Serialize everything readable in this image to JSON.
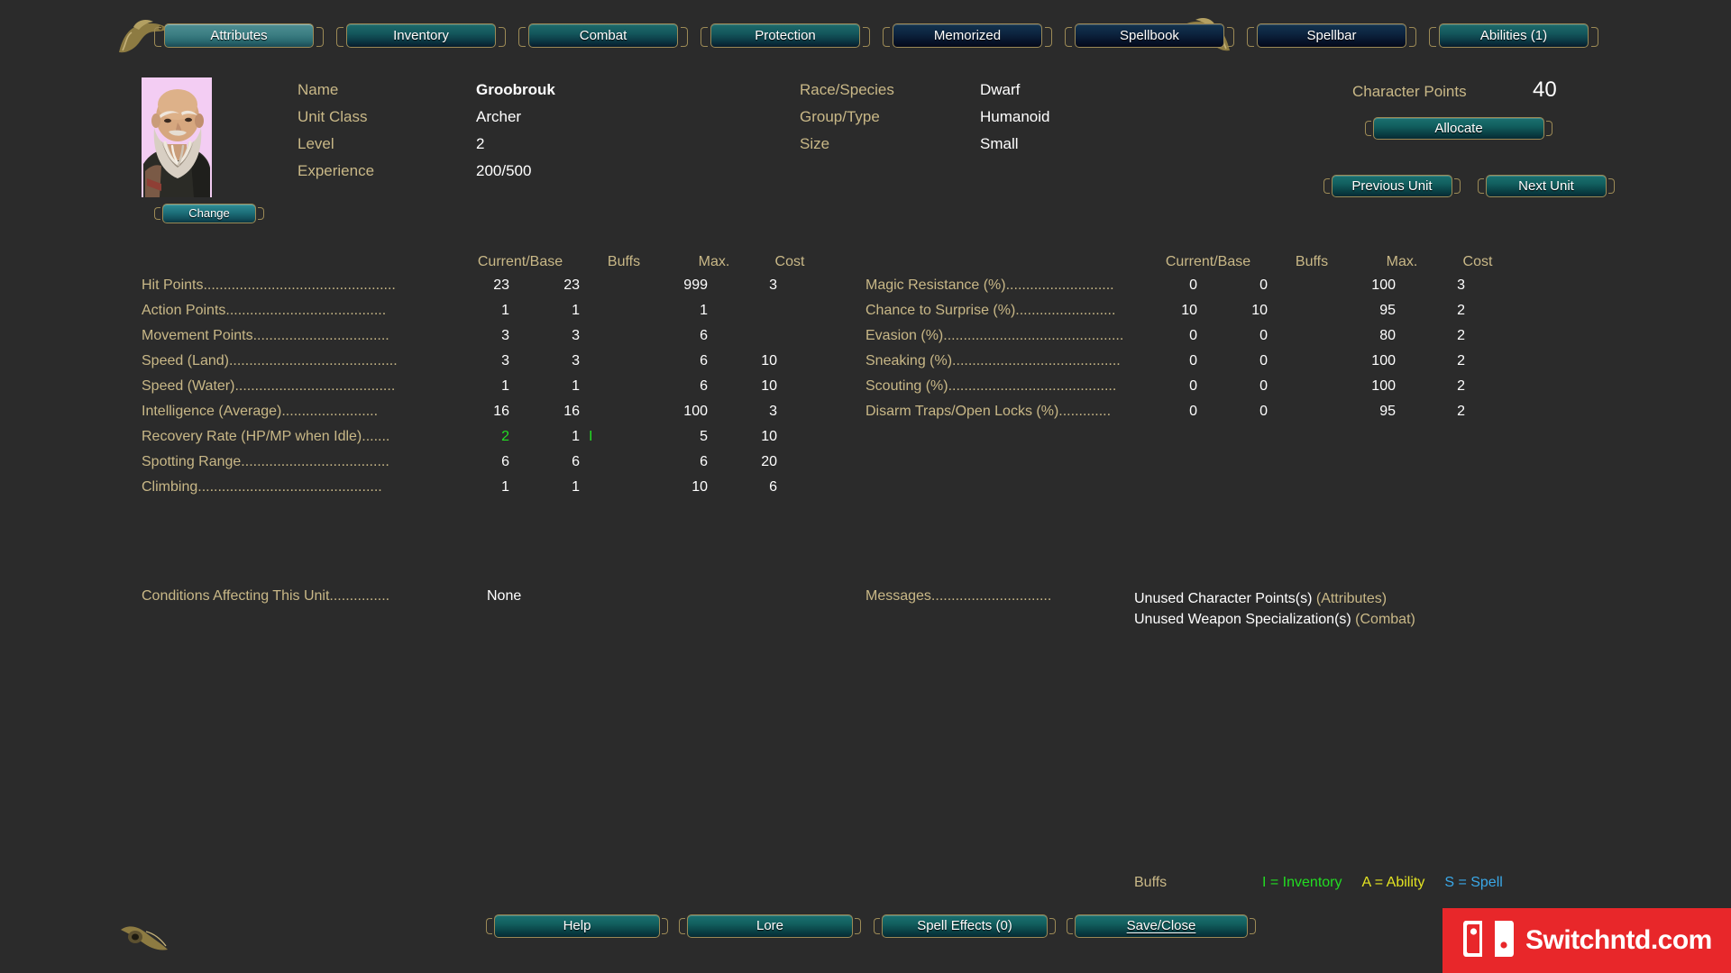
{
  "tabs": [
    {
      "label": "Attributes",
      "state": "active"
    },
    {
      "label": "Inventory",
      "state": "enabled"
    },
    {
      "label": "Combat",
      "state": "enabled"
    },
    {
      "label": "Protection",
      "state": "enabled"
    },
    {
      "label": "Memorized",
      "state": "disabled"
    },
    {
      "label": "Spellbook",
      "state": "disabled"
    },
    {
      "label": "Spellbar",
      "state": "disabled"
    },
    {
      "label": "Abilities (1)",
      "state": "enabled"
    }
  ],
  "character": {
    "portrait_change_label": "Change",
    "fields_left": [
      {
        "label": "Name",
        "value": "Groobrouk",
        "bold": true
      },
      {
        "label": "Unit Class",
        "value": "Archer",
        "bold": false
      },
      {
        "label": "Level",
        "value": "2",
        "bold": false
      },
      {
        "label": "Experience",
        "value": "200/500",
        "bold": false
      }
    ],
    "fields_mid": [
      {
        "label": "Race/Species",
        "value": "Dwarf"
      },
      {
        "label": "Group/Type",
        "value": "Humanoid"
      },
      {
        "label": "Size",
        "value": "Small"
      }
    ],
    "character_points_label": "Character Points",
    "character_points_value": "40",
    "allocate_label": "Allocate",
    "previous_unit_label": "Previous Unit",
    "next_unit_label": "Next Unit"
  },
  "columns": {
    "current_base": "Current/Base",
    "buffs": "Buffs",
    "max": "Max.",
    "cost": "Cost"
  },
  "stats_left": [
    {
      "name": "Hit Points",
      "dots": "................................................",
      "current": "23",
      "base": "23",
      "buff": "",
      "max": "999",
      "cost": "3",
      "current_green": false
    },
    {
      "name": "Action Points",
      "dots": "........................................",
      "current": "1",
      "base": "1",
      "buff": "",
      "max": "1",
      "cost": "",
      "current_green": false
    },
    {
      "name": "Movement Points",
      "dots": "..................................",
      "current": "3",
      "base": "3",
      "buff": "",
      "max": "6",
      "cost": "",
      "current_green": false
    },
    {
      "name": "Speed (Land)",
      "dots": "..........................................",
      "current": "3",
      "base": "3",
      "buff": "",
      "max": "6",
      "cost": "10",
      "current_green": false
    },
    {
      "name": "Speed (Water)",
      "dots": "........................................",
      "current": "1",
      "base": "1",
      "buff": "",
      "max": "6",
      "cost": "10",
      "current_green": false
    },
    {
      "name": "Intelligence (Average)",
      "dots": "........................",
      "current": "16",
      "base": "16",
      "buff": "",
      "max": "100",
      "cost": "3",
      "current_green": false
    },
    {
      "name": "Recovery Rate (HP/MP when Idle)",
      "dots": ".......",
      "current": "2",
      "base": "1",
      "buff": "I",
      "max": "5",
      "cost": "10",
      "current_green": true
    },
    {
      "name": "Spotting Range",
      "dots": ".....................................",
      "current": "6",
      "base": "6",
      "buff": "",
      "max": "6",
      "cost": "20",
      "current_green": false
    },
    {
      "name": "Climbing",
      "dots": "..............................................",
      "current": "1",
      "base": "1",
      "buff": "",
      "max": "10",
      "cost": "6",
      "current_green": false
    }
  ],
  "stats_right": [
    {
      "name": "Magic Resistance (%)",
      "dots": "...........................",
      "current": "0",
      "base": "0",
      "buff": "",
      "max": "100",
      "cost": "3"
    },
    {
      "name": "Chance to Surprise (%)",
      "dots": ".........................",
      "current": "10",
      "base": "10",
      "buff": "",
      "max": "95",
      "cost": "2"
    },
    {
      "name": "Evasion (%)",
      "dots": ".............................................",
      "current": "0",
      "base": "0",
      "buff": "",
      "max": "80",
      "cost": "2"
    },
    {
      "name": "Sneaking (%)",
      "dots": "..........................................",
      "current": "0",
      "base": "0",
      "buff": "",
      "max": "100",
      "cost": "2"
    },
    {
      "name": "Scouting (%)",
      "dots": "..........................................",
      "current": "0",
      "base": "0",
      "buff": "",
      "max": "100",
      "cost": "2"
    },
    {
      "name": "Disarm Traps/Open Locks (%)",
      "dots": ".............",
      "current": "0",
      "base": "0",
      "buff": "",
      "max": "95",
      "cost": "2"
    }
  ],
  "conditions": {
    "label": "Conditions Affecting This Unit...............",
    "value": "None"
  },
  "messages": {
    "label": "Messages..............................",
    "items": [
      {
        "text": "Unused Character Points(s) ",
        "context": "(Attributes)"
      },
      {
        "text": "Unused Weapon Specialization(s) ",
        "context": "(Combat)"
      }
    ]
  },
  "buff_legend": {
    "title": "Buffs",
    "entries": [
      {
        "text": "I = Inventory",
        "color": "#22dd22"
      },
      {
        "text": "A = Ability",
        "color": "#e3e322"
      },
      {
        "text": "S = Spell",
        "color": "#3aa8e8"
      }
    ]
  },
  "bottom_buttons": {
    "help": "Help",
    "lore": "Lore",
    "spell_effects": "Spell Effects (0)",
    "save_close": "Save/Close"
  },
  "watermark": {
    "text": "Switchntd.com",
    "background": "#e8272a"
  }
}
